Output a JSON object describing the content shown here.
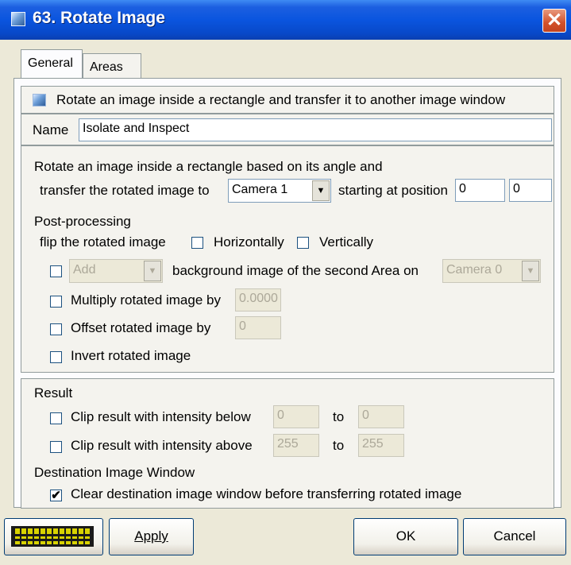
{
  "window": {
    "title": "63. Rotate Image"
  },
  "tabs": [
    {
      "label": "General"
    },
    {
      "label": "Areas"
    }
  ],
  "description": "Rotate an image inside a rectangle and transfer it to another image window",
  "name": {
    "label": "Name",
    "value": "Isolate and Inspect"
  },
  "rotate": {
    "line1": "Rotate an image inside a rectangle based on its angle and",
    "line2": "transfer the rotated image to",
    "camera": "Camera 1",
    "starting_label": "starting at position",
    "pos_x": "0",
    "pos_y": "0"
  },
  "post": {
    "heading": "Post-processing",
    "flip_label": "flip the rotated image",
    "horizontally": {
      "label": "Horizontally",
      "checked": false
    },
    "vertically": {
      "label": "Vertically",
      "checked": false
    },
    "background": {
      "checked": false,
      "op": "Add",
      "label": "background image of the second Area on",
      "camera": "Camera 0"
    },
    "multiply": {
      "checked": false,
      "label": "Multiply rotated image by",
      "value": "0.0000"
    },
    "offset": {
      "checked": false,
      "label": "Offset rotated image by",
      "value": "0"
    },
    "invert": {
      "checked": false,
      "label": "Invert rotated image"
    }
  },
  "result": {
    "heading": "Result",
    "clip_below": {
      "checked": false,
      "label": "Clip result with intensity below",
      "from": "0",
      "to_label": "to",
      "to": "0"
    },
    "clip_above": {
      "checked": false,
      "label": "Clip result with intensity above",
      "from": "255",
      "to_label": "to",
      "to": "255"
    },
    "dest_heading": "Destination Image Window",
    "clear_dest": {
      "checked": true,
      "label": "Clear destination image window before transferring rotated image"
    }
  },
  "buttons": {
    "apply": "Apply",
    "ok": "OK",
    "cancel": "Cancel"
  },
  "checkmark": "✔",
  "icons": {
    "close": "close-icon",
    "keyboard": "keyboard-icon",
    "image": "image-icon"
  }
}
